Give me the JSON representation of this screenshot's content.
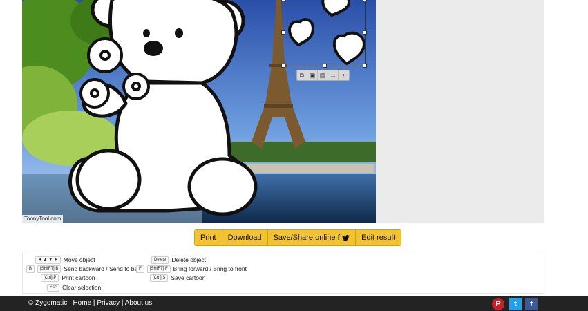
{
  "canvas": {
    "watermark": "ToonyTool.com"
  },
  "object_toolbar": {
    "buttons": [
      {
        "icon": "copy-icon"
      },
      {
        "icon": "bring-front-icon"
      },
      {
        "icon": "send-back-icon"
      },
      {
        "icon": "flip-horizontal-icon"
      },
      {
        "icon": "flip-vertical-icon"
      }
    ]
  },
  "actions": {
    "print": "Print",
    "download": "Download",
    "save_share": "Save/Share online",
    "edit_result": "Edit result"
  },
  "shortcuts": {
    "move": {
      "keys": "◄ ▲ ▼ ►",
      "label": "Move object"
    },
    "delete": {
      "keys": "Delete",
      "label": "Delete object"
    },
    "send_back": {
      "key1": "B",
      "key2": "[SHIFT] B",
      "label": "Send backward / Send to back"
    },
    "bring_front": {
      "key1": "F",
      "key2": "[SHIFT] F",
      "label": "Bring forward / Bring to front"
    },
    "print": {
      "keys": "[Ctrl] P",
      "label": "Print cartoon"
    },
    "save": {
      "keys": "[Ctrl] S",
      "label": "Save cartoon"
    },
    "clear": {
      "keys": "Esc",
      "label": "Clear selection"
    }
  },
  "footer": {
    "copyright": "© Zygomatic",
    "home": "Home",
    "privacy": "Privacy",
    "about": "About us",
    "sep": "|"
  },
  "social": {
    "pinterest": "P",
    "twitter": "t",
    "facebook": "f"
  },
  "colors": {
    "button_bg": "#f2c230",
    "footer_bg": "#232323",
    "pinterest": "#cb2027",
    "twitter": "#1da1f2",
    "facebook": "#3b5998"
  }
}
